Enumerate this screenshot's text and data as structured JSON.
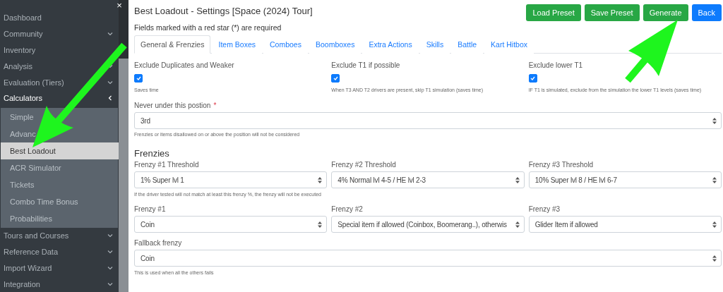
{
  "sidebar": {
    "close": "×",
    "items": [
      {
        "label": "Dashboard",
        "kind": "link"
      },
      {
        "label": "Community",
        "kind": "group",
        "expanded": false
      },
      {
        "label": "Inventory",
        "kind": "link"
      },
      {
        "label": "Analysis",
        "kind": "group",
        "expanded": false
      },
      {
        "label": "Evaluation (Tiers)",
        "kind": "group",
        "expanded": false
      },
      {
        "label": "Calculators",
        "kind": "group",
        "expanded": true,
        "children": [
          {
            "label": "Simple",
            "selected": false
          },
          {
            "label": "Advanc",
            "selected": false
          },
          {
            "label": "Best Loadout",
            "selected": true
          },
          {
            "label": "ACR Simulator",
            "selected": false
          },
          {
            "label": "Tickets",
            "selected": false
          },
          {
            "label": "Combo Time Bonus",
            "selected": false
          },
          {
            "label": "Probabilities",
            "selected": false
          }
        ]
      },
      {
        "label": "Tours and Courses",
        "kind": "group",
        "expanded": false
      },
      {
        "label": "Reference Data",
        "kind": "group",
        "expanded": false
      },
      {
        "label": "Import Wizard",
        "kind": "group",
        "expanded": false
      },
      {
        "label": "Integration",
        "kind": "group",
        "expanded": false
      }
    ]
  },
  "header": {
    "title": "Best Loadout - Settings [Space (2024) Tour]",
    "buttons": [
      {
        "label": "Load Preset",
        "kind": "success"
      },
      {
        "label": "Save Preset",
        "kind": "success"
      },
      {
        "label": "Generate",
        "kind": "success"
      },
      {
        "label": "Back",
        "kind": "primary"
      }
    ],
    "note": "Fields marked with a red star (*) are required"
  },
  "tabs": [
    {
      "label": "General & Frenzies",
      "selected": true
    },
    {
      "label": "Item Boxes",
      "selected": false
    },
    {
      "label": "Comboes",
      "selected": false
    },
    {
      "label": "Boomboxes",
      "selected": false
    },
    {
      "label": "Extra Actions",
      "selected": false
    },
    {
      "label": "Skills",
      "selected": false
    },
    {
      "label": "Battle",
      "selected": false
    },
    {
      "label": "Kart Hitbox",
      "selected": false
    }
  ],
  "options": [
    {
      "label": "Exclude Duplicates and Weaker",
      "checked": true,
      "hint": "Saves time"
    },
    {
      "label": "Exclude T1 if possible",
      "checked": true,
      "hint": "When T3 AND T2 drivers are present, skip T1 simulation (saves time)"
    },
    {
      "label": "Exclude lower T1",
      "checked": true,
      "hint": "IF T1 is simulated, exclude from the simulation the lower T1 levels (saves time)"
    }
  ],
  "position": {
    "label": "Never under this postion",
    "required_mark": "*",
    "value": "3rd",
    "hint": "Frenzies or items disallowed on or above the position will not be considered"
  },
  "frenzies": {
    "heading": "Frenzies",
    "rows": [
      {
        "fields": [
          {
            "label": "Frenzy #1 Threshold",
            "value": "1% Super lvl 1",
            "hint": "If the driver tested will not match at least this frenzy %, the frenzy will not be executed"
          },
          {
            "label": "Frenzy #2 Threshold",
            "value": "4% Normal lvl 4-5 / HE lvl 2-3"
          },
          {
            "label": "Frenzy #3 Threshold",
            "value": "10% Super lvl 8 / HE lvl 6-7"
          }
        ]
      },
      {
        "fields": [
          {
            "label": "Frenzy #1",
            "value": "Coin"
          },
          {
            "label": "Frenzy #2",
            "value": "Special item if allowed (Coinbox, Boomerang..), otherwis"
          },
          {
            "label": "Frenzy #3",
            "value": "Glider Item if allowed"
          }
        ]
      }
    ],
    "fallback": {
      "label": "Fallback frenzy",
      "value": "Coin",
      "hint": "This is used when all the others fails"
    }
  }
}
